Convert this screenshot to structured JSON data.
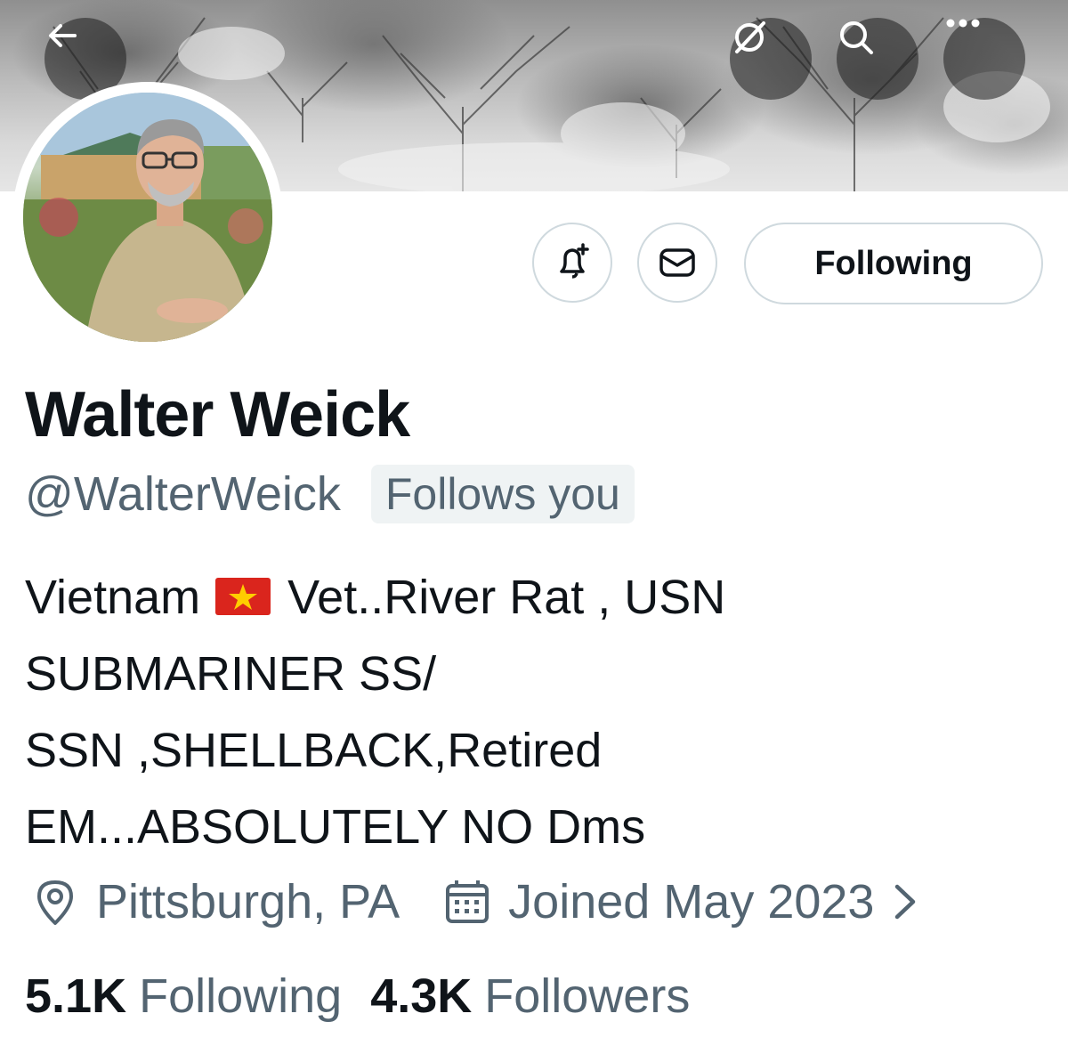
{
  "header": {
    "back_icon": "arrow-left-icon",
    "actions": [
      "grok-icon",
      "search-icon",
      "more-icon"
    ]
  },
  "profile": {
    "name": "Walter Weick",
    "handle": "@WalterWeick",
    "follows_you": "Follows you",
    "bio_lines": [
      {
        "before": "Vietnam ",
        "emoji": "vietnam-flag-icon",
        "after": " Vet..River Rat , USN"
      },
      {
        "text": "SUBMARINER SS/"
      },
      {
        "text": "SSN ,SHELLBACK,Retired"
      },
      {
        "text": "EM...ABSOLUTELY NO Dms"
      }
    ],
    "location": "Pittsburgh, PA",
    "joined": "Joined May 2023",
    "following_count": "5.1K",
    "following_label": "Following",
    "followers_count": "4.3K",
    "followers_label": "Followers"
  },
  "actions": {
    "notify_icon": "bell-plus-icon",
    "message_icon": "envelope-icon",
    "follow_label": "Following"
  }
}
